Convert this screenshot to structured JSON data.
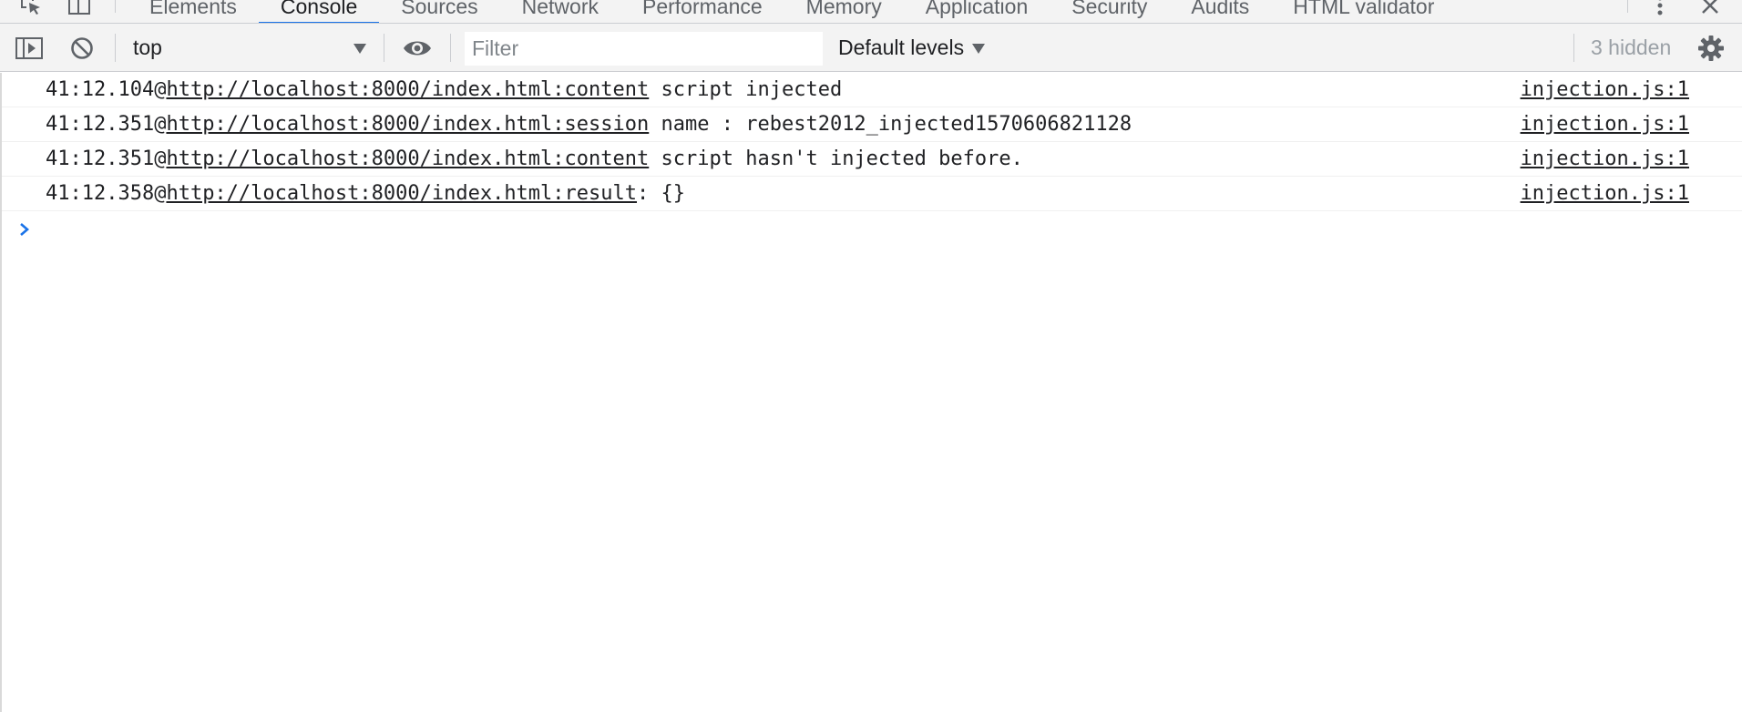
{
  "tabs": [
    {
      "label": "Elements",
      "active": false
    },
    {
      "label": "Console",
      "active": true
    },
    {
      "label": "Sources",
      "active": false
    },
    {
      "label": "Network",
      "active": false
    },
    {
      "label": "Performance",
      "active": false
    },
    {
      "label": "Memory",
      "active": false
    },
    {
      "label": "Application",
      "active": false
    },
    {
      "label": "Security",
      "active": false
    },
    {
      "label": "Audits",
      "active": false
    },
    {
      "label": "HTML validator",
      "active": false
    }
  ],
  "toolbar": {
    "context": "top",
    "filter_placeholder": "Filter",
    "levels": "Default levels",
    "hidden_count": "3 hidden"
  },
  "messages": [
    {
      "time": "41:12.104@",
      "url": "http://localhost:8000/index.html:content",
      "text": " script injected",
      "source": "injection.js:1"
    },
    {
      "time": "41:12.351@",
      "url": "http://localhost:8000/index.html:session",
      "text": " name : rebest2012_injected1570606821128",
      "source": "injection.js:1"
    },
    {
      "time": "41:12.351@",
      "url": "http://localhost:8000/index.html:content",
      "text": " script hasn't injected before.",
      "source": "injection.js:1"
    },
    {
      "time": "41:12.358@",
      "url": "http://localhost:8000/index.html:result",
      "text": ": {}",
      "source": "injection.js:1"
    }
  ],
  "colors": {
    "accent": "#1a73e8",
    "toolbar_bg": "#f3f3f3",
    "text": "#202124",
    "muted": "#9aa0a6"
  },
  "icons": [
    "inspect-element-icon",
    "device-toolbar-icon",
    "kebab-menu-icon",
    "close-icon",
    "sidebar-toggle-icon",
    "clear-console-icon",
    "eye-icon",
    "settings-gear-icon",
    "prompt-chevron-icon"
  ]
}
